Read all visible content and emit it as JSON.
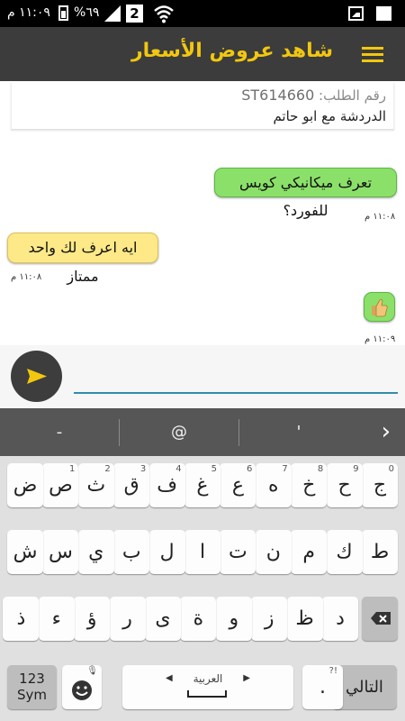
{
  "status_bar": {
    "time": "١١:٠٩ م",
    "battery_pct": "%٦٩",
    "sim_slot": "2"
  },
  "app_bar": {
    "title": "شاهد عروض الأسعار",
    "menu_icon": "hamburger-menu-icon"
  },
  "order": {
    "label": "رقم الطلب:",
    "number": "ST614660",
    "chat_with": "الدردشة مع ابو حاتم"
  },
  "messages": [
    {
      "text": "تعرف ميكانيكي كويس للفورد؟",
      "time": "١١:٠٨ م",
      "side": "right",
      "color": "#8be06a"
    },
    {
      "text": "ايه اعرف لك واحد ممتاز",
      "time": "١١:٠٨ م",
      "side": "left",
      "color": "#fde987"
    },
    {
      "text": "",
      "icon": "thumbs-up-icon",
      "time": "١١:٠٩ م",
      "side": "right",
      "color": "#8be06a"
    }
  ],
  "composer": {
    "placeholder": "",
    "send_icon": "send-icon"
  },
  "keyboard": {
    "suggestions": [
      "-",
      "@",
      "'"
    ],
    "row1": [
      {
        "k": "ج",
        "h": "0"
      },
      {
        "k": "ح",
        "h": "9"
      },
      {
        "k": "خ",
        "h": "8"
      },
      {
        "k": "ه",
        "h": "7"
      },
      {
        "k": "ع",
        "h": "6"
      },
      {
        "k": "غ",
        "h": "5"
      },
      {
        "k": "ف",
        "h": "4"
      },
      {
        "k": "ق",
        "h": "3"
      },
      {
        "k": "ث",
        "h": "2"
      },
      {
        "k": "ص",
        "h": "1"
      },
      {
        "k": "ض",
        "h": ""
      }
    ],
    "row2": [
      "ط",
      "ك",
      "م",
      "ن",
      "ت",
      "ا",
      "ل",
      "ب",
      "ي",
      "س",
      "ش"
    ],
    "row3": [
      "د",
      "ظ",
      "ز",
      "و",
      "ة",
      "ى",
      "ر",
      "ؤ",
      "ء",
      "ذ"
    ],
    "next_label": "التالي",
    "period_label": ".",
    "space_label": "العربية",
    "sym_label_1": "123",
    "sym_label_2": "Sym",
    "accent_color": "#f2c70f"
  }
}
